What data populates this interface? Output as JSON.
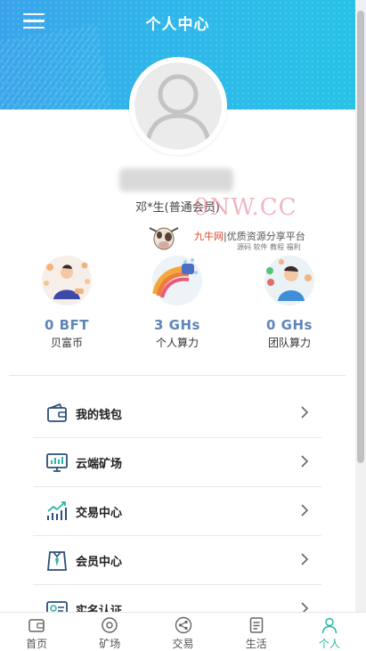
{
  "header": {
    "title": "个人中心"
  },
  "profile": {
    "member_text": "邓*生(普通会员)"
  },
  "watermark": {
    "text": "9NW.CC",
    "brand_red": "九牛网",
    "brand_rest": "|优质资源分享平台",
    "sub": "源码 软件 教程 福利"
  },
  "stats": [
    {
      "value": "0 BFT",
      "label": "贝富币"
    },
    {
      "value": "3 GHs",
      "label": "个人算力"
    },
    {
      "value": "0 GHs",
      "label": "团队算力"
    }
  ],
  "menu": [
    {
      "label": "我的钱包",
      "icon": "wallet-icon"
    },
    {
      "label": "云端矿场",
      "icon": "monitor-chart-icon"
    },
    {
      "label": "交易中心",
      "icon": "trend-chart-icon"
    },
    {
      "label": "会员中心",
      "icon": "member-tie-icon"
    },
    {
      "label": "实名认证",
      "icon": "id-card-icon"
    }
  ],
  "tabs": [
    {
      "label": "首页",
      "icon": "wallet-home-icon"
    },
    {
      "label": "矿场",
      "icon": "mine-circle-icon"
    },
    {
      "label": "交易",
      "icon": "share-icon"
    },
    {
      "label": "生活",
      "icon": "document-icon"
    },
    {
      "label": "个人",
      "icon": "person-icon",
      "active": true
    }
  ],
  "colors": {
    "accent": "#2bb7a3",
    "stat_value": "#5f86b8",
    "header_start": "#3aa3ea",
    "header_end": "#27c3e6"
  }
}
